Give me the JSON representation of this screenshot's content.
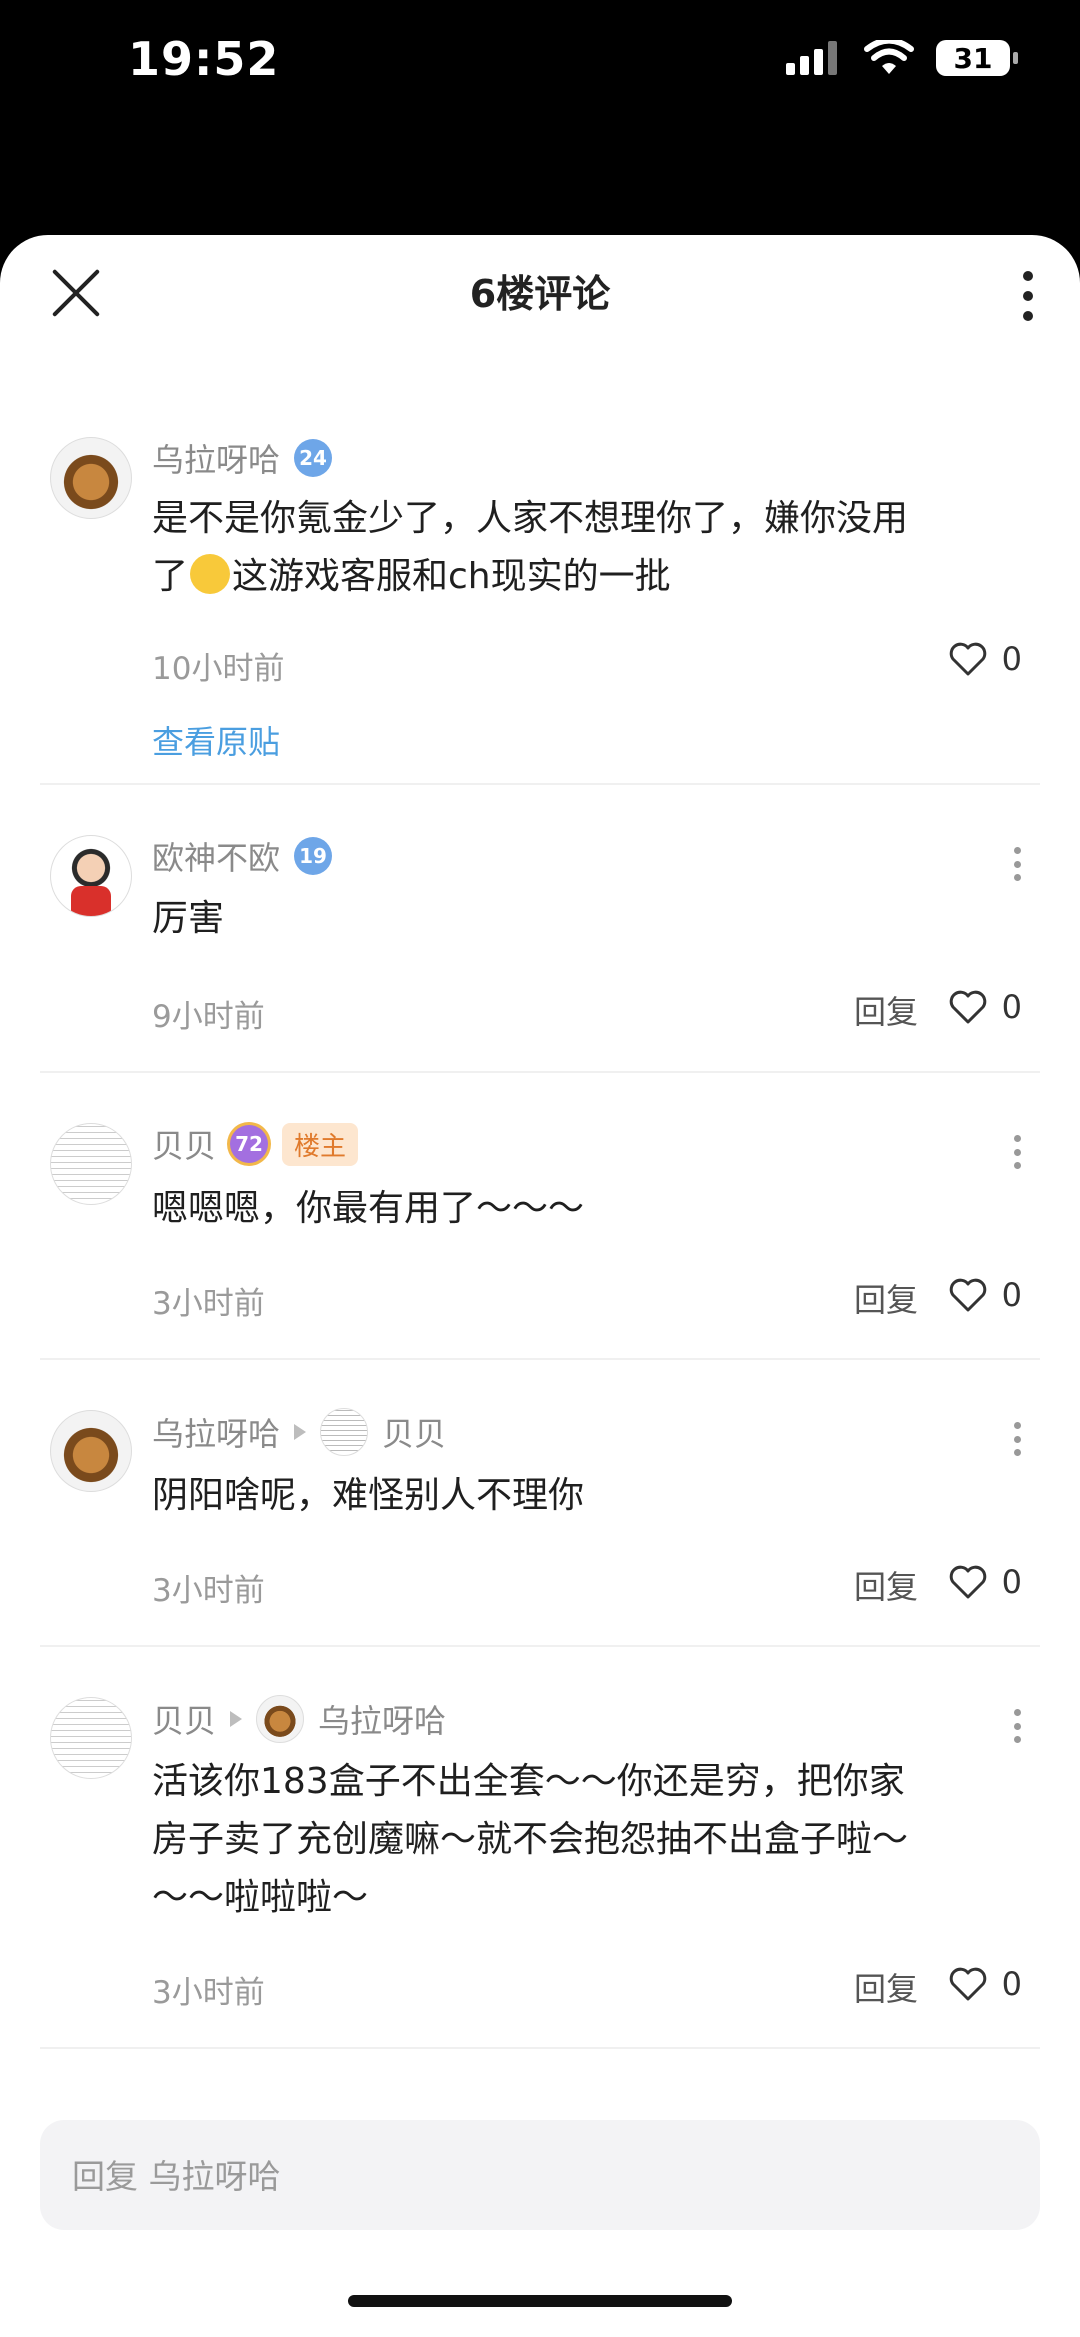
{
  "status": {
    "time": "19:52",
    "battery": "31"
  },
  "header": {
    "title": "6楼评论"
  },
  "comments": [
    {
      "name": "乌拉呀哈",
      "level": "24",
      "text_a": "是不是你氪金少了，人家不想理你了，嫌你没用",
      "text_b": "了",
      "text_c": "这游戏客服和ch现实的一批",
      "time": "10小时前",
      "likes": "0",
      "view_original": "查看原贴"
    },
    {
      "name": "欧神不欧",
      "level": "19",
      "text": "厉害",
      "time": "9小时前",
      "reply": "回复",
      "likes": "0"
    },
    {
      "name": "贝贝",
      "level": "72",
      "badge": "楼主",
      "text": "嗯嗯嗯，你最有用了～～～",
      "time": "3小时前",
      "reply": "回复",
      "likes": "0"
    },
    {
      "name": "乌拉呀哈",
      "reply_to": "贝贝",
      "text": "阴阳啥呢，难怪别人不理你",
      "time": "3小时前",
      "reply": "回复",
      "likes": "0"
    },
    {
      "name": "贝贝",
      "reply_to": "乌拉呀哈",
      "line1": "活该你183盒子不出全套～～你还是穷，把你家",
      "line2": "房子卖了充创魔嘛～就不会抱怨抽不出盒子啦～",
      "line3": "～～啦啦啦～",
      "time": "3小时前",
      "reply": "回复",
      "likes": "0"
    }
  ],
  "input": {
    "placeholder": "回复 乌拉呀哈"
  }
}
